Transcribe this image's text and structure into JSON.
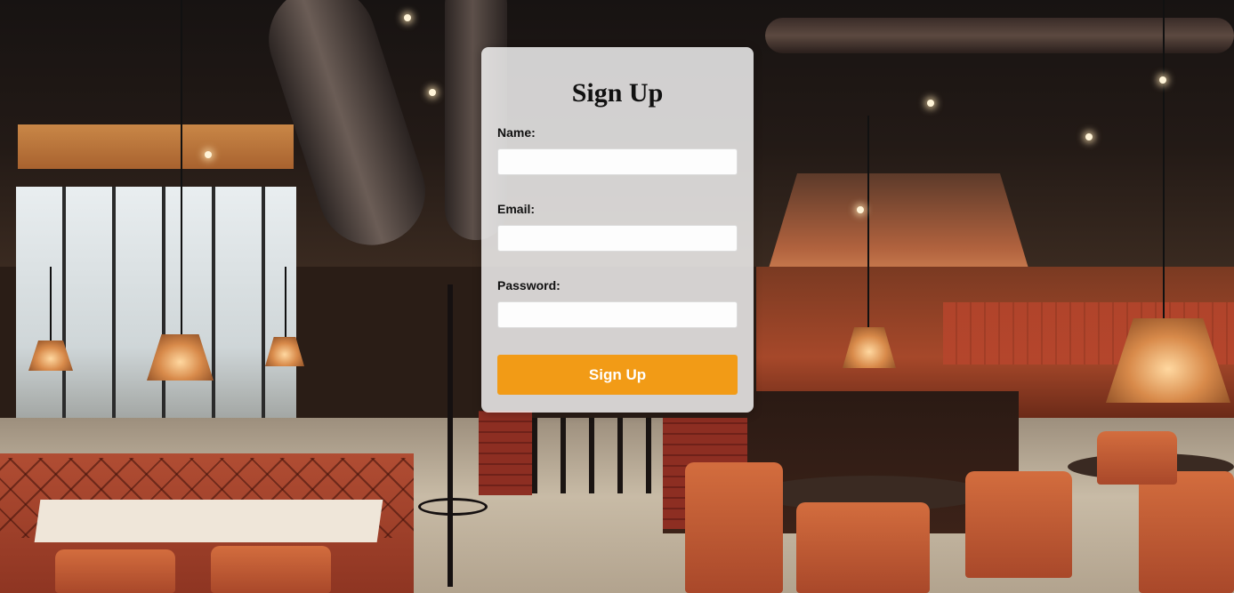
{
  "form": {
    "title": "Sign Up",
    "fields": [
      {
        "label": "Name:",
        "value": "",
        "placeholder": ""
      },
      {
        "label": "Email:",
        "value": "",
        "placeholder": ""
      },
      {
        "label": "Password:",
        "value": "",
        "placeholder": ""
      }
    ],
    "submit_label": "Sign Up"
  },
  "colors": {
    "button_background": "#f29b16",
    "button_text": "#ffffff",
    "card_background": "rgba(255,255,255,0.80)"
  }
}
